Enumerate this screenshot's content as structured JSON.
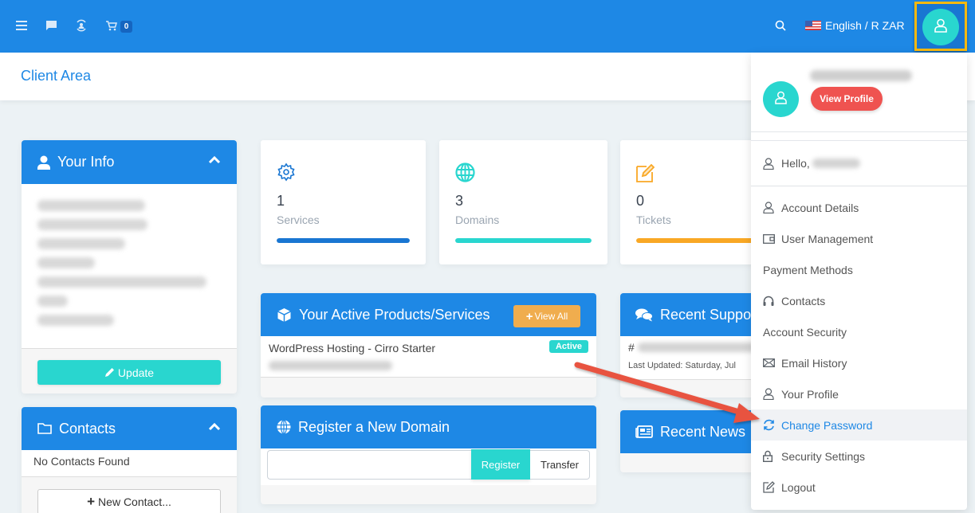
{
  "topbar": {
    "icons": [
      "menu-icon",
      "chat-icon",
      "refresh-user-icon",
      "cart-icon"
    ],
    "cart_count": "0",
    "search_icon": "search-icon",
    "language_label": "English / R ZAR",
    "user_icon": "user-icon"
  },
  "page": {
    "title": "Client Area"
  },
  "your_info": {
    "title": "Your Info",
    "lines_blurred": 7,
    "update_label": "Update"
  },
  "contacts": {
    "title": "Contacts",
    "empty_text": "No Contacts Found",
    "new_contact_label": "New Contact..."
  },
  "stats": [
    {
      "icon": "gear-icon",
      "count": "1",
      "label": "Services",
      "color": "#1976d2"
    },
    {
      "icon": "globe-icon",
      "count": "3",
      "label": "Domains",
      "color": "#29d6cf"
    },
    {
      "icon": "edit-icon",
      "count": "0",
      "label": "Tickets",
      "color": "#f9a825"
    }
  ],
  "products": {
    "title": "Your Active Products/Services",
    "view_all_label": "View All",
    "items": [
      {
        "name": "WordPress Hosting - Cirro Starter",
        "status": "Active"
      }
    ]
  },
  "register_domain": {
    "title": "Register a New Domain",
    "input_value": "",
    "register_label": "Register",
    "transfer_label": "Transfer"
  },
  "support": {
    "title": "Recent Support Tickets",
    "ticket_prefix": "#",
    "last_updated": "Last Updated: Saturday, Jul"
  },
  "news": {
    "title": "Recent News"
  },
  "dropdown": {
    "view_profile_label": "View Profile",
    "hello_label": "Hello,",
    "items": [
      {
        "label": "Account Details",
        "icon": "user-icon"
      },
      {
        "label": "User Management",
        "icon": "wallet-icon"
      },
      {
        "label": "Payment Methods",
        "icon": ""
      },
      {
        "label": "Contacts",
        "icon": "headphones-icon"
      },
      {
        "label": "Account Security",
        "icon": ""
      },
      {
        "label": "Email History",
        "icon": "envelope-icon"
      },
      {
        "label": "Your Profile",
        "icon": "user-icon"
      },
      {
        "label": "Change Password",
        "icon": "refresh-icon",
        "active": true
      },
      {
        "label": "Security Settings",
        "icon": "lock-icon"
      },
      {
        "label": "Logout",
        "icon": "edit-icon"
      }
    ]
  },
  "colors": {
    "primary": "#1e88e5",
    "accent_teal": "#29d6cf",
    "warning": "#f0ad4e",
    "danger": "#ef5350",
    "highlight_border": "#f9b90f",
    "annotation_arrow": "#e8533f"
  }
}
